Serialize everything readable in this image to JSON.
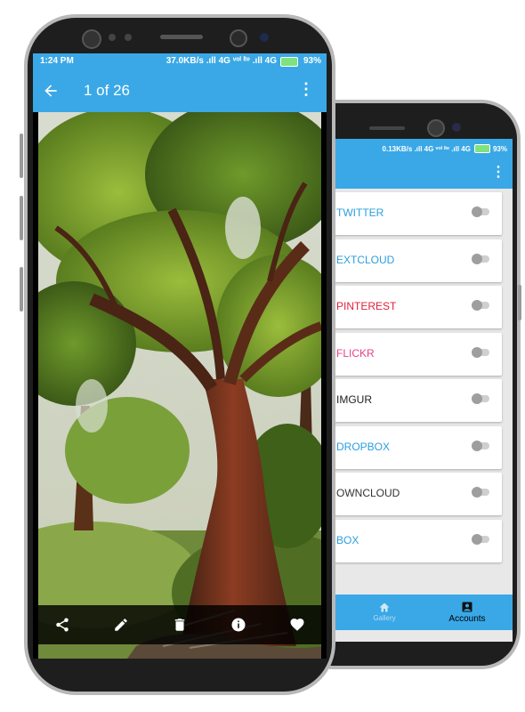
{
  "front_phone": {
    "status_bar": {
      "time": "1:24 PM",
      "network_info": "37.0KB/s .ıll 4G ᵛᵒˡ ˡᵗᵉ .ıll 4G",
      "battery": "93%"
    },
    "toolbar": {
      "back_icon": "arrow-left-icon",
      "title": "1 of 26",
      "menu_icon": "more-vertical-icon"
    },
    "bottom_actions": [
      {
        "icon": "share-icon"
      },
      {
        "icon": "edit-icon"
      },
      {
        "icon": "delete-icon"
      },
      {
        "icon": "info-icon"
      },
      {
        "icon": "favorite-icon"
      }
    ]
  },
  "back_phone": {
    "status_bar": {
      "network_info": "0.13KB/s .ıll 4G ᵛᵒˡ ˡᵗᵉ .ıll 4G",
      "battery": "93%"
    },
    "accounts": [
      {
        "label": "TWITTER",
        "color": "#2b9fe0"
      },
      {
        "label": "EXTCLOUD",
        "color": "#2b9fe0"
      },
      {
        "label": "PINTEREST",
        "color": "#e0223a"
      },
      {
        "label": "FLICKR",
        "color": "#e8408a"
      },
      {
        "label": "IMGUR",
        "color": "#222222"
      },
      {
        "label": "DROPBOX",
        "color": "#2b9fe0"
      },
      {
        "label": "OWNCLOUD",
        "color": "#333333"
      },
      {
        "label": "BOX",
        "color": "#2b9fe0"
      }
    ],
    "bottom_nav": {
      "gallery_label": "Gallery",
      "accounts_label": "Accounts"
    }
  },
  "colors": {
    "accent": "#3aa8e6"
  }
}
